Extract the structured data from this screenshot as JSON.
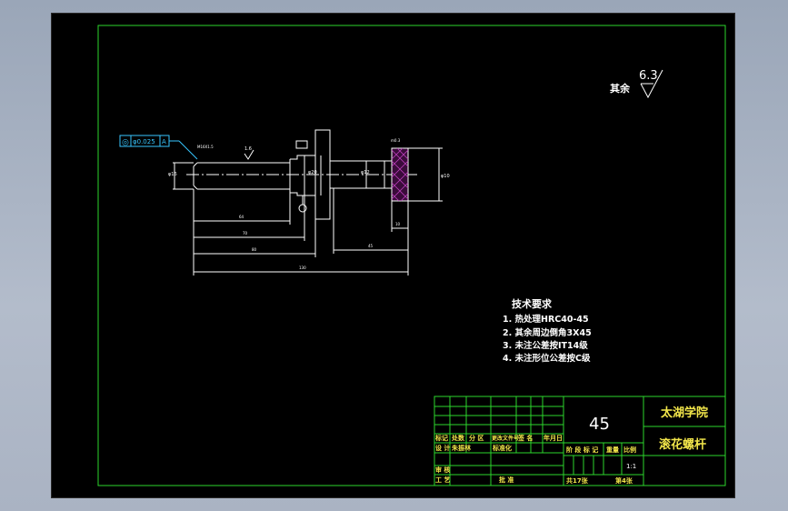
{
  "surface_finish": {
    "label": "其余",
    "value": "6.3"
  },
  "tolerance_frame": {
    "symbol": "◎",
    "value": "φ0.025",
    "datum": "A"
  },
  "tech_requirements": {
    "title": "技术要求",
    "items": [
      "1. 热处理HRC40-45",
      "2. 其余周边倒角3X45",
      "3. 未注公差按IT14级",
      "4. 未注形位公差按C级"
    ]
  },
  "title_block": {
    "material": "45",
    "school": "太湖学院",
    "part_name": "滚花螺杆",
    "scale": "1:1",
    "sheets": "共17张",
    "sheet_no": "第4张",
    "header_row": [
      "标记",
      "处数",
      "分 区",
      "更改文件号",
      "签 名",
      "年月日"
    ],
    "design_row": [
      "设 计",
      "朱振林",
      "标准化"
    ],
    "stage_labels": [
      "阶 段 标 记",
      "重量",
      "比例"
    ],
    "check_row": [
      "审 核"
    ],
    "craft_row": [
      "工 艺",
      "批 准"
    ]
  }
}
